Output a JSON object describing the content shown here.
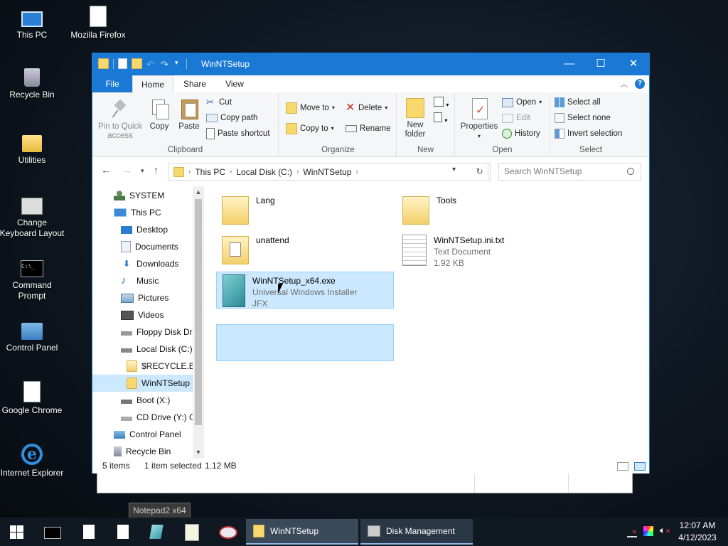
{
  "desktop": {
    "icons": [
      {
        "label": "This PC"
      },
      {
        "label": "Mozilla Firefox"
      },
      {
        "label": "Recycle Bin"
      },
      {
        "label": "Utilities"
      },
      {
        "label": "Change Keyboard Layout"
      },
      {
        "label": "Command Prompt"
      },
      {
        "label": "Control Panel"
      },
      {
        "label": "Google Chrome"
      },
      {
        "label": "Internet Explorer"
      }
    ]
  },
  "window": {
    "title": "WinNTSetup",
    "controls": {
      "minimize": "—",
      "maximize": "☐",
      "close": "✕"
    },
    "tabs": [
      "File",
      "Home",
      "Share",
      "View"
    ],
    "ribbon": {
      "clipboard": {
        "label": "Clipboard",
        "pin": "Pin to Quick access",
        "copy": "Copy",
        "paste": "Paste",
        "cut": "Cut",
        "copy_path": "Copy path",
        "paste_shortcut": "Paste shortcut"
      },
      "organize": {
        "label": "Organize",
        "move_to": "Move to",
        "copy_to": "Copy to",
        "delete": "Delete",
        "rename": "Rename"
      },
      "new": {
        "label": "New",
        "new_folder": "New folder"
      },
      "open": {
        "label": "Open",
        "properties": "Properties",
        "open": "Open",
        "edit": "Edit",
        "history": "History"
      },
      "select": {
        "label": "Select",
        "select_all": "Select all",
        "select_none": "Select none",
        "invert": "Invert selection"
      }
    },
    "address": {
      "crumbs": [
        "This PC",
        "Local Disk (C:)",
        "WinNTSetup"
      ],
      "search_placeholder": "Search WinNTSetup"
    },
    "nav_pane": [
      {
        "label": "SYSTEM"
      },
      {
        "label": "This PC"
      },
      {
        "label": "Desktop"
      },
      {
        "label": "Documents"
      },
      {
        "label": "Downloads"
      },
      {
        "label": "Music"
      },
      {
        "label": "Pictures"
      },
      {
        "label": "Videos"
      },
      {
        "label": "Floppy Disk Dri"
      },
      {
        "label": "Local Disk (C:)"
      },
      {
        "label": "$RECYCLE.BIN"
      },
      {
        "label": "WinNTSetup"
      },
      {
        "label": "Boot (X:)"
      },
      {
        "label": "CD Drive (Y:) G"
      },
      {
        "label": "Control Panel"
      },
      {
        "label": "Recycle Bin"
      }
    ],
    "files": [
      {
        "name": "Lang",
        "line2": "",
        "line3": ""
      },
      {
        "name": "Tools",
        "line2": "",
        "line3": ""
      },
      {
        "name": "unattend",
        "line2": "",
        "line3": ""
      },
      {
        "name": "WinNTSetup.ini.txt",
        "line2": "Text Document",
        "line3": "1.92 KB"
      },
      {
        "name": "WinNTSetup_x64.exe",
        "line2": "Universal Windows Installer",
        "line3": "JFX"
      }
    ],
    "status": {
      "items": "5 items",
      "selected": "1 item selected",
      "size": "1.12 MB"
    }
  },
  "tooltip": "Notepad2 x64",
  "taskbar": {
    "tasks": [
      {
        "label": "WinNTSetup"
      },
      {
        "label": "Disk Management"
      }
    ],
    "time": "12:07 AM",
    "date": "4/12/2023"
  }
}
